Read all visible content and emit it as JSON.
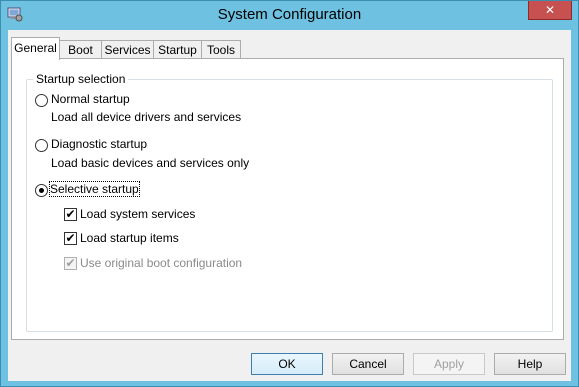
{
  "window": {
    "title": "System Configuration"
  },
  "tabs": [
    {
      "label": "General",
      "active": true
    },
    {
      "label": "Boot",
      "active": false
    },
    {
      "label": "Services",
      "active": false
    },
    {
      "label": "Startup",
      "active": false
    },
    {
      "label": "Tools",
      "active": false
    }
  ],
  "startup_selection": {
    "group_title": "Startup selection",
    "options": [
      {
        "label": "Normal startup",
        "description": "Load all device drivers and services",
        "selected": false
      },
      {
        "label": "Diagnostic startup",
        "description": "Load basic devices and services only",
        "selected": false
      },
      {
        "label": "Selective startup",
        "description": "",
        "selected": true
      }
    ],
    "checkboxes": [
      {
        "label": "Load system services",
        "checked": true,
        "enabled": true
      },
      {
        "label": "Load startup items",
        "checked": true,
        "enabled": true
      },
      {
        "label": "Use original boot configuration",
        "checked": true,
        "enabled": false
      }
    ]
  },
  "buttons": {
    "ok": "OK",
    "cancel": "Cancel",
    "apply": "Apply",
    "help": "Help"
  },
  "icons": {
    "close": "✕",
    "check": "✔"
  },
  "colors": {
    "frame": "#6ec1e0",
    "close_button": "#c75050",
    "dialog_bg": "#f0f0f0"
  }
}
